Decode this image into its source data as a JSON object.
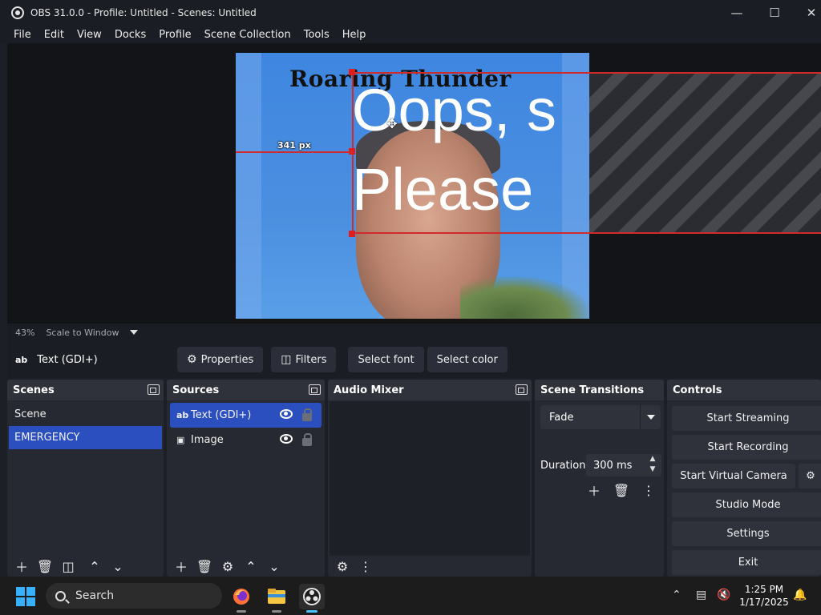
{
  "window": {
    "title": "OBS 31.0.0 - Profile: Untitled - Scenes: Untitled"
  },
  "menu": [
    "File",
    "Edit",
    "View",
    "Docks",
    "Profile",
    "Scene Collection",
    "Tools",
    "Help"
  ],
  "preview": {
    "image_title": "Roaring Thunder",
    "text_line1": "Oops, s",
    "text_line2": "Please",
    "distance_label": "341 px"
  },
  "zoombar": {
    "zoom": "43%",
    "scale_mode": "Scale to Window"
  },
  "context": {
    "source_icon": "ab",
    "source_name": "Text (GDI+)",
    "buttons": {
      "properties": "Properties",
      "filters": "Filters",
      "select_font": "Select font",
      "select_color": "Select color"
    }
  },
  "scenes": {
    "title": "Scenes",
    "items": [
      "Scene",
      "EMERGENCY"
    ],
    "selected": "EMERGENCY"
  },
  "sources": {
    "title": "Sources",
    "items": [
      {
        "icon": "ab",
        "label": "Text (GDI+)",
        "selected": true
      },
      {
        "icon": "image-icon",
        "label": "Image",
        "selected": false
      }
    ]
  },
  "audio": {
    "title": "Audio Mixer"
  },
  "transitions": {
    "title": "Scene Transitions",
    "selected": "Fade",
    "duration_label": "Duration",
    "duration_value": "300 ms"
  },
  "controls": {
    "title": "Controls",
    "buttons": [
      "Start Streaming",
      "Start Recording",
      "Start Virtual Camera",
      "Studio Mode",
      "Settings",
      "Exit"
    ]
  },
  "taskbar": {
    "search_placeholder": "Search",
    "time": "1:25 PM",
    "date": "1/17/2025"
  },
  "colors": {
    "selection": "#2b4fbf",
    "bounding_box": "#d12a2a",
    "windows_accent": "#37b1ff"
  }
}
